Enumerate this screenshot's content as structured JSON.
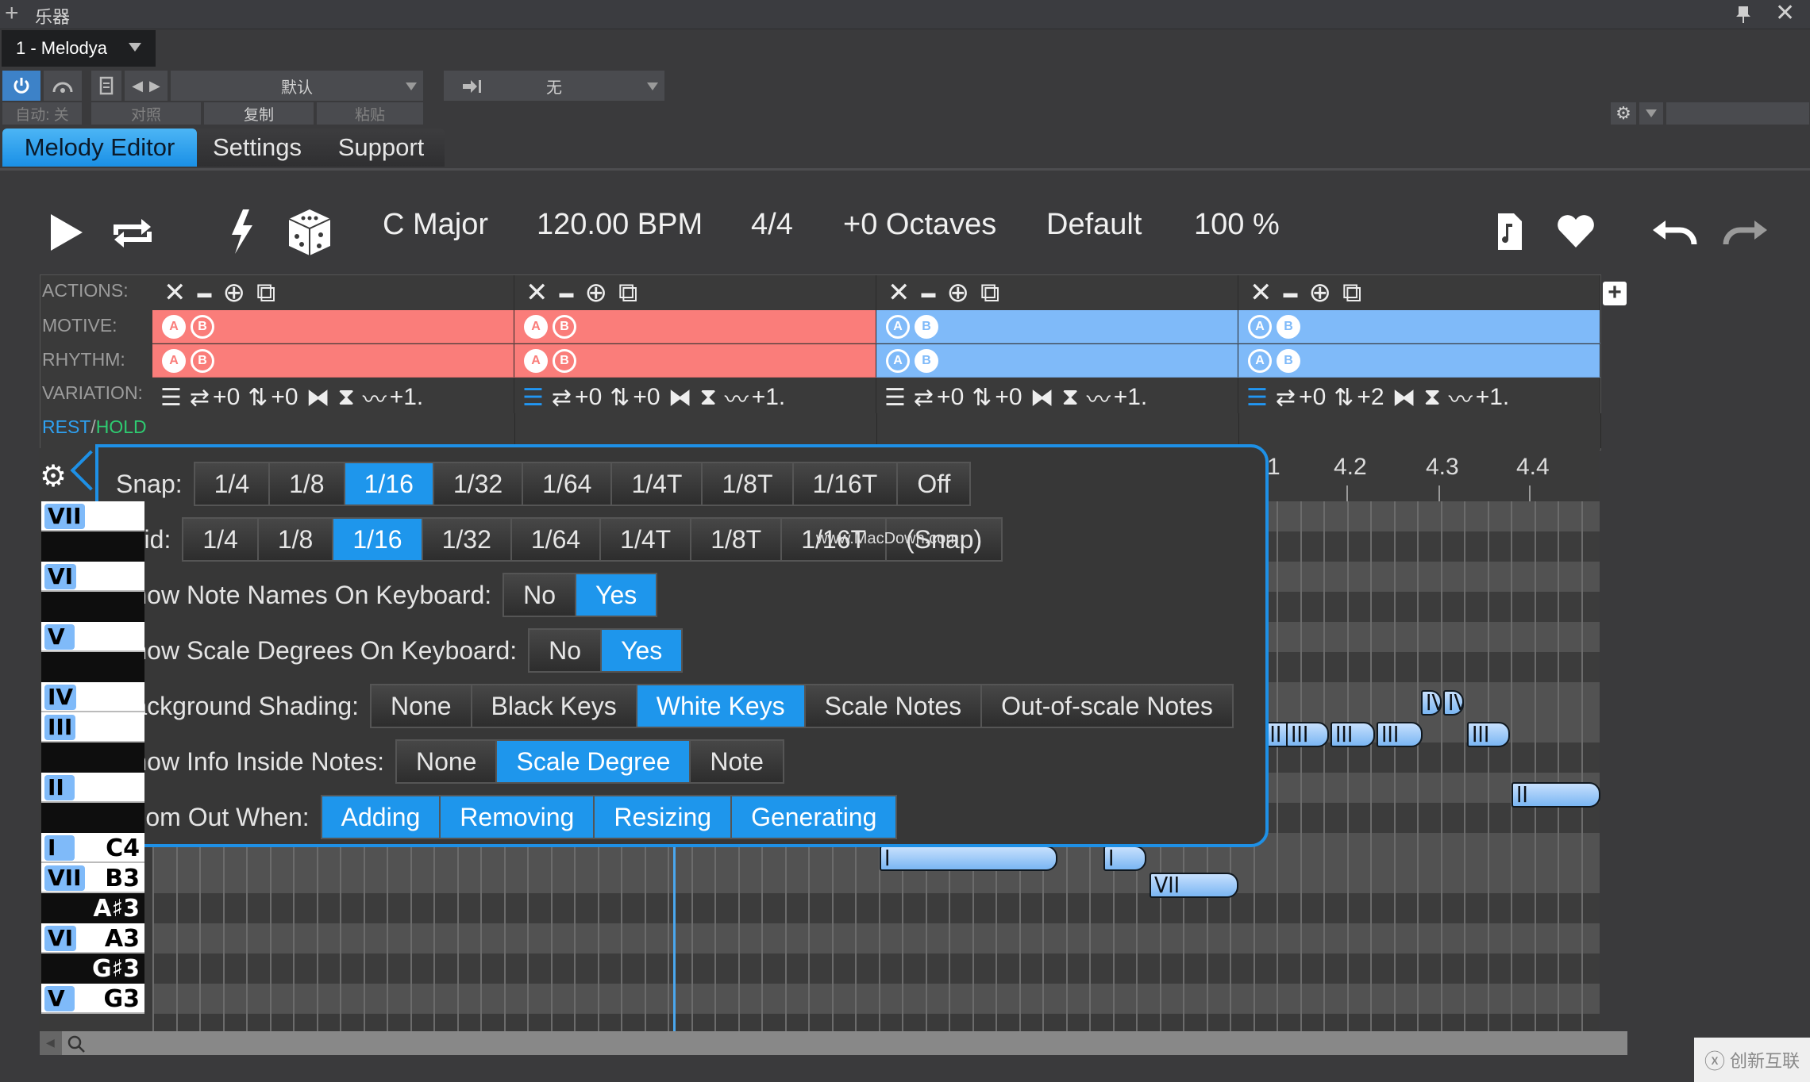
{
  "window": {
    "title": "乐器",
    "icons": {
      "add": "plus-icon",
      "pin": "pin-icon",
      "close": "close-icon"
    }
  },
  "instrument": {
    "name": "1 - Melodya"
  },
  "preset_bar": {
    "power": "power-icon",
    "link": "link-icon",
    "preset_name": "默认",
    "routing": "无",
    "auto": "自动: 关",
    "compare": "对照",
    "copy": "复制",
    "paste": "粘贴"
  },
  "tabs": [
    {
      "label": "Melody Editor",
      "active": true
    },
    {
      "label": "Settings",
      "active": false
    },
    {
      "label": "Support",
      "active": false
    }
  ],
  "transport": {
    "key": "C Major",
    "bpm": "120.00 BPM",
    "time_signature": "4/4",
    "octaves": "+0 Octaves",
    "preset": "Default",
    "percent": "100 %"
  },
  "pattern": {
    "labels": {
      "actions": "ACTIONS:",
      "motive": "MOTIVE:",
      "rhythm": "RHYTHM:",
      "variation": "VARIATION:",
      "rest": "REST",
      "slash": "/",
      "hold": "HOLD"
    },
    "sections": [
      {
        "color": "red",
        "motive": "A",
        "rhythm": "A",
        "var": {
          "list_on": false,
          "swap": "+0",
          "shift": "+0",
          "curve": "+1."
        }
      },
      {
        "color": "red",
        "motive": "A",
        "rhythm": "A",
        "var": {
          "list_on": true,
          "swap": "+0",
          "shift": "+0",
          "curve": "+1."
        }
      },
      {
        "color": "blue",
        "motive": "B",
        "rhythm": "B",
        "var": {
          "list_on": false,
          "swap": "+0",
          "shift": "+0",
          "curve": "+1."
        }
      },
      {
        "color": "blue",
        "motive": "B",
        "rhythm": "B",
        "var": {
          "list_on": true,
          "swap": "+0",
          "shift": "+2",
          "curve": "+1."
        }
      }
    ],
    "ab": {
      "a": "A",
      "b": "B"
    }
  },
  "ruler": [
    "1",
    "4.2",
    "4.3",
    "4.4"
  ],
  "keyboard": [
    {
      "deg": "VII",
      "name": "",
      "type": "w"
    },
    {
      "deg": "",
      "name": "",
      "type": "b"
    },
    {
      "deg": "VI",
      "name": "",
      "type": "w"
    },
    {
      "deg": "",
      "name": "",
      "type": "b"
    },
    {
      "deg": "V",
      "name": "",
      "type": "w"
    },
    {
      "deg": "",
      "name": "",
      "type": "b"
    },
    {
      "deg": "IV",
      "name": "",
      "type": "w"
    },
    {
      "deg": "III",
      "name": "",
      "type": "w"
    },
    {
      "deg": "",
      "name": "",
      "type": "b"
    },
    {
      "deg": "II",
      "name": "",
      "type": "w"
    },
    {
      "deg": "",
      "name": "",
      "type": "b"
    },
    {
      "deg": "I",
      "name": "C4",
      "type": "w"
    },
    {
      "deg": "VII",
      "name": "B3",
      "type": "w"
    },
    {
      "deg": "",
      "name": "A♯3",
      "type": "b"
    },
    {
      "deg": "VI",
      "name": "A3",
      "type": "w"
    },
    {
      "deg": "",
      "name": "G♯3",
      "type": "b"
    },
    {
      "deg": "V",
      "name": "G3",
      "type": "w"
    }
  ],
  "notes": [
    {
      "label": "III"
    },
    {
      "label": "III"
    },
    {
      "label": "III"
    },
    {
      "label": "III"
    },
    {
      "label": "III"
    },
    {
      "label": "IV"
    },
    {
      "label": "IV"
    },
    {
      "label": "II"
    },
    {
      "label": "I"
    },
    {
      "label": "I"
    },
    {
      "label": "VII"
    }
  ],
  "settings_popover": {
    "snap": {
      "label": "Snap:",
      "options": [
        "1/4",
        "1/8",
        "1/16",
        "1/32",
        "1/64",
        "1/4T",
        "1/8T",
        "1/16T",
        "Off"
      ],
      "selected": "1/16"
    },
    "grid": {
      "label": "Grid:",
      "options": [
        "1/4",
        "1/8",
        "1/16",
        "1/32",
        "1/64",
        "1/4T",
        "1/8T",
        "1/16T",
        "(Snap)"
      ],
      "selected": "1/16"
    },
    "note_names": {
      "label": "Show Note Names On Keyboard:",
      "options": [
        "No",
        "Yes"
      ],
      "selected": "Yes"
    },
    "scale_degrees": {
      "label": "Show Scale Degrees On Keyboard:",
      "options": [
        "No",
        "Yes"
      ],
      "selected": "Yes"
    },
    "background_shading": {
      "label": "Background Shading:",
      "options": [
        "None",
        "Black Keys",
        "White Keys",
        "Scale Notes",
        "Out-of-scale Notes"
      ],
      "selected": "White Keys"
    },
    "info_inside_notes": {
      "label": "Show Info Inside Notes:",
      "options": [
        "None",
        "Scale Degree",
        "Note"
      ],
      "selected": "Scale Degree"
    },
    "zoom_out_when": {
      "label": "Zoom Out When:",
      "options": [
        "Adding",
        "Removing",
        "Resizing",
        "Generating"
      ],
      "selected": [
        "Adding",
        "Removing",
        "Resizing",
        "Generating"
      ]
    }
  },
  "watermarks": {
    "macdown": "www.MacDown.com",
    "brand": "创新互联"
  },
  "colors": {
    "accent": "#1e96ec",
    "red_section": "#fa7d7a",
    "blue_section": "#7fbaf9"
  }
}
